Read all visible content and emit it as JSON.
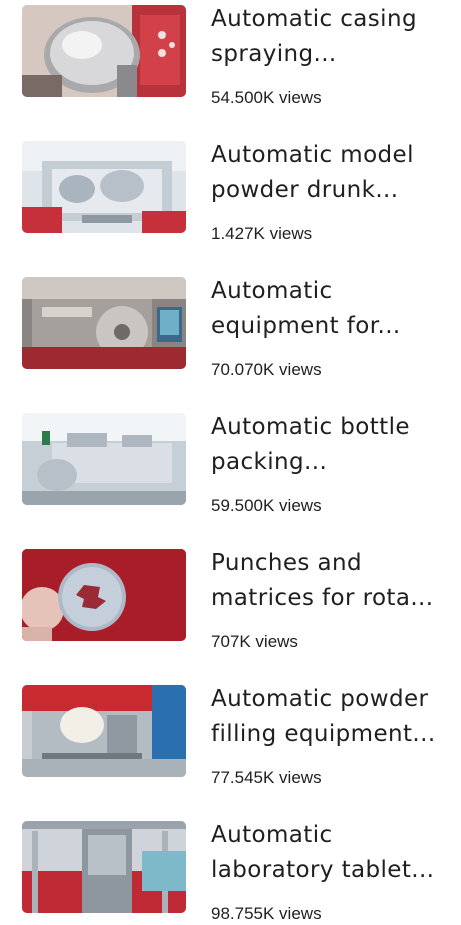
{
  "videos": [
    {
      "title_line1": "Automatic casing",
      "title_line2": "spraying...",
      "views": "54.500K views",
      "thumb_icon": "coating-pan-machine"
    },
    {
      "title_line1": "Automatic model",
      "title_line2": "powder drunk...",
      "views": "1.427K views",
      "thumb_icon": "powder-mixing-machine"
    },
    {
      "title_line1": "Automatic",
      "title_line2": "equipment for...",
      "views": "70.070K views",
      "thumb_icon": "packaging-equipment"
    },
    {
      "title_line1": "Automatic bottle",
      "title_line2": "packing...",
      "views": "59.500K views",
      "thumb_icon": "bottle-packing-line"
    },
    {
      "title_line1": "Punches and",
      "title_line2": "matrices for rota...",
      "views": "707K views",
      "thumb_icon": "punch-die-part"
    },
    {
      "title_line1": "Automatic powder",
      "title_line2": "filling equipment...",
      "views": "77.545K views",
      "thumb_icon": "powder-filling-machine"
    },
    {
      "title_line1": "Automatic",
      "title_line2": "laboratory tablet...",
      "views": "98.755K views",
      "thumb_icon": "tablet-press-machine"
    }
  ],
  "colors": {
    "text": "#1f1f1f",
    "background": "#ffffff",
    "accent_red": "#c0202a"
  }
}
